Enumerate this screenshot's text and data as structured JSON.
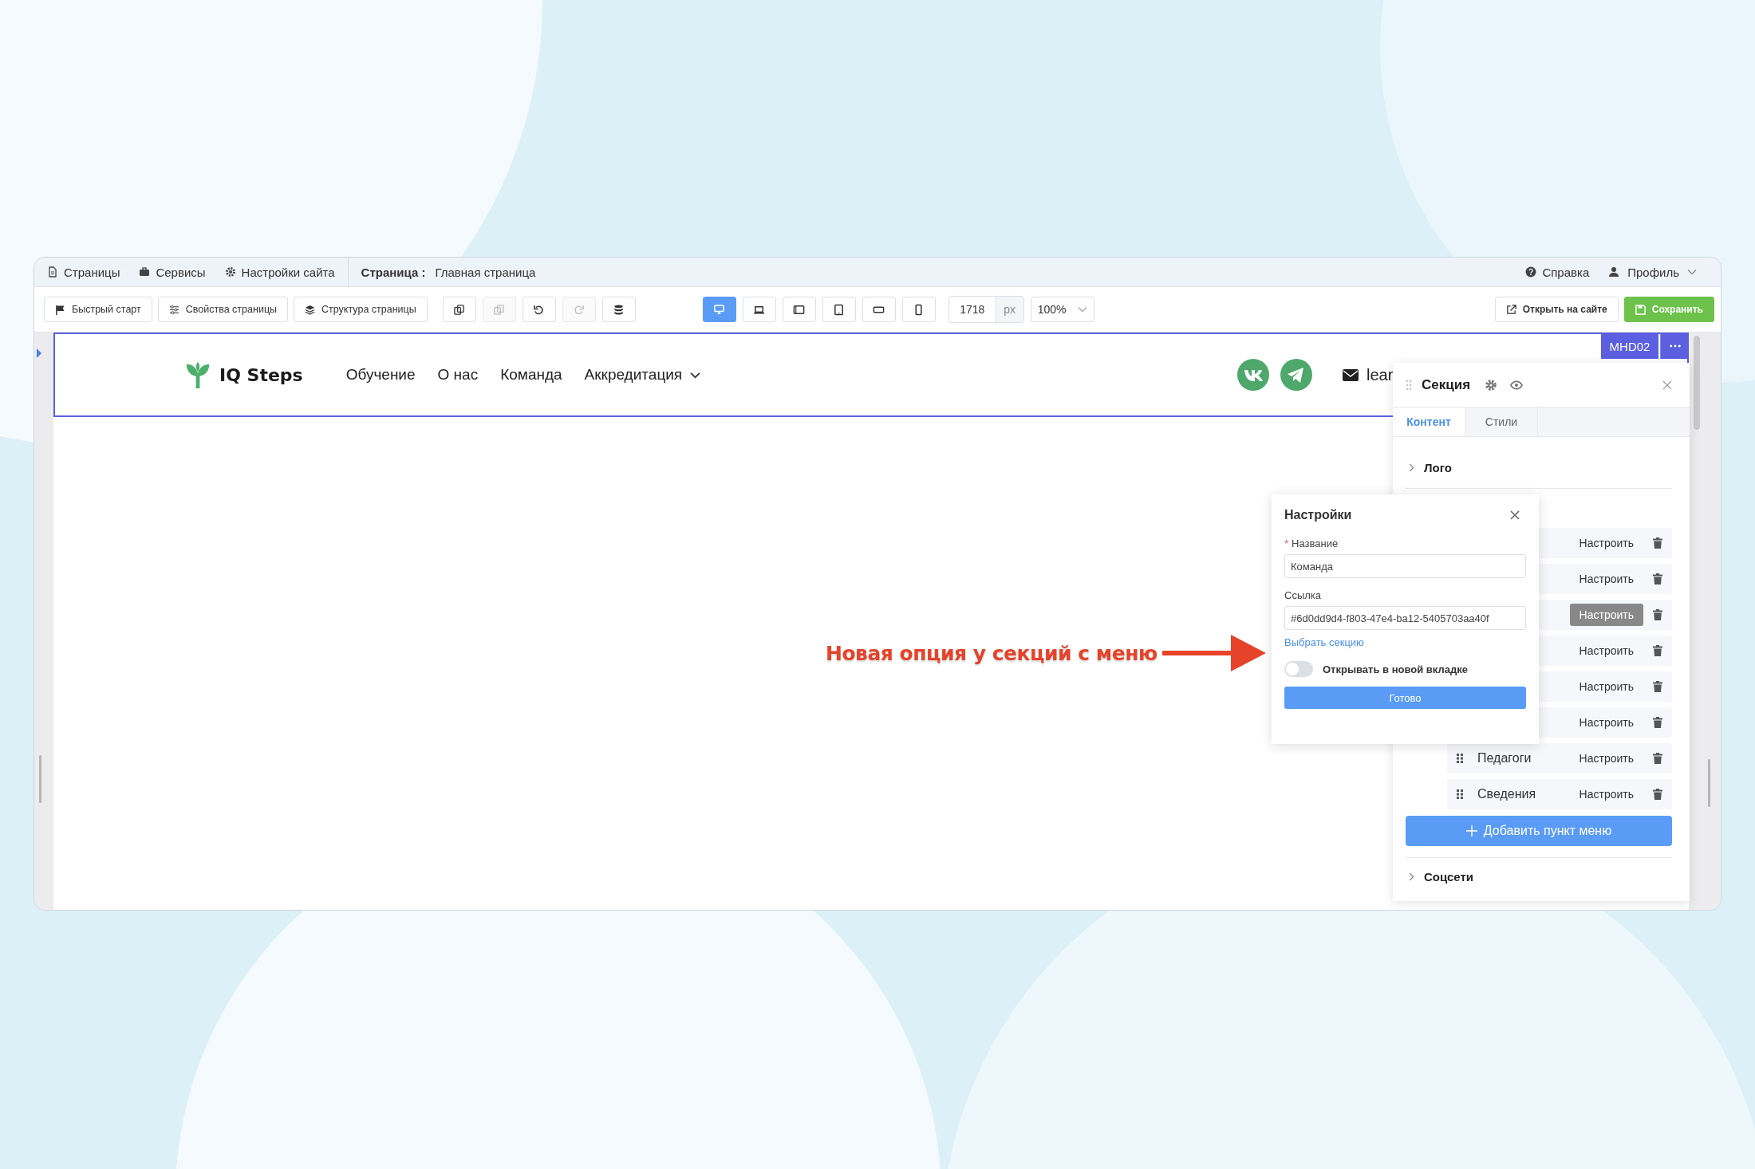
{
  "top_bar": {
    "items": [
      "Страницы",
      "Сервисы",
      "Настройки сайта"
    ],
    "page_label": "Страница :",
    "page_name": "Главная страница",
    "help": "Справка",
    "profile": "Профиль"
  },
  "toolbar": {
    "buttons": [
      "Быстрый старт",
      "Свойства страницы",
      "Структура страницы"
    ],
    "edit_buttons": [
      {
        "disabled": false
      },
      {
        "disabled": true
      },
      {
        "disabled": false
      },
      {
        "disabled": true
      },
      {
        "disabled": false
      }
    ],
    "device_buttons": [
      {
        "selected": true
      },
      {
        "selected": false
      },
      {
        "selected": false
      },
      {
        "selected": false
      },
      {
        "selected": false
      },
      {
        "selected": false
      }
    ],
    "width_value": "1718",
    "width_unit": "px",
    "zoom": "100%",
    "open_site": "Открыть на сайте",
    "save": "Сохранить"
  },
  "site_header": {
    "logo": "IQ Steps",
    "nav": [
      {
        "label": "Обучение",
        "dropdown": false
      },
      {
        "label": "О нас",
        "dropdown": false
      },
      {
        "label": "Команда",
        "dropdown": false
      },
      {
        "label": "Аккредитация",
        "dropdown": true
      }
    ],
    "email": "lear",
    "badge": "MHD02"
  },
  "panel": {
    "title": "Секция",
    "tabs": [
      {
        "label": "Контент",
        "selected": true
      },
      {
        "label": "Стили",
        "selected": false
      }
    ],
    "logo_section": "Лого",
    "menu_items": [
      {
        "button": "Настроить",
        "highlighted": false
      },
      {
        "button": "Настроить",
        "highlighted": false
      },
      {
        "button": "Настроить",
        "highlighted": true
      },
      {
        "button": "Настроить",
        "highlighted": false
      },
      {
        "button": "Настроить",
        "highlighted": false
      },
      {
        "button": "Настроить",
        "highlighted": false
      },
      {
        "name": "Педагоги",
        "button": "Настроить",
        "highlighted": false
      },
      {
        "name": "Сведения",
        "button": "Настроить",
        "highlighted": false
      }
    ],
    "add_button": "Добавить пункт меню",
    "social_section": "Соцсети"
  },
  "settings_popup": {
    "title": "Настройки",
    "required_mark": "*",
    "name_label": "Название",
    "name_value": "Команда",
    "link_label": "Ссылка",
    "link_value": "#6d0dd9d4-f803-47e4-ba12-5405703aa40f",
    "pick_link": "Выбрать секцию",
    "new_tab": {
      "label": "Открывать в новой вкладке",
      "on": false
    },
    "done": "Готово"
  },
  "annotation": "Новая опция у секций с меню"
}
